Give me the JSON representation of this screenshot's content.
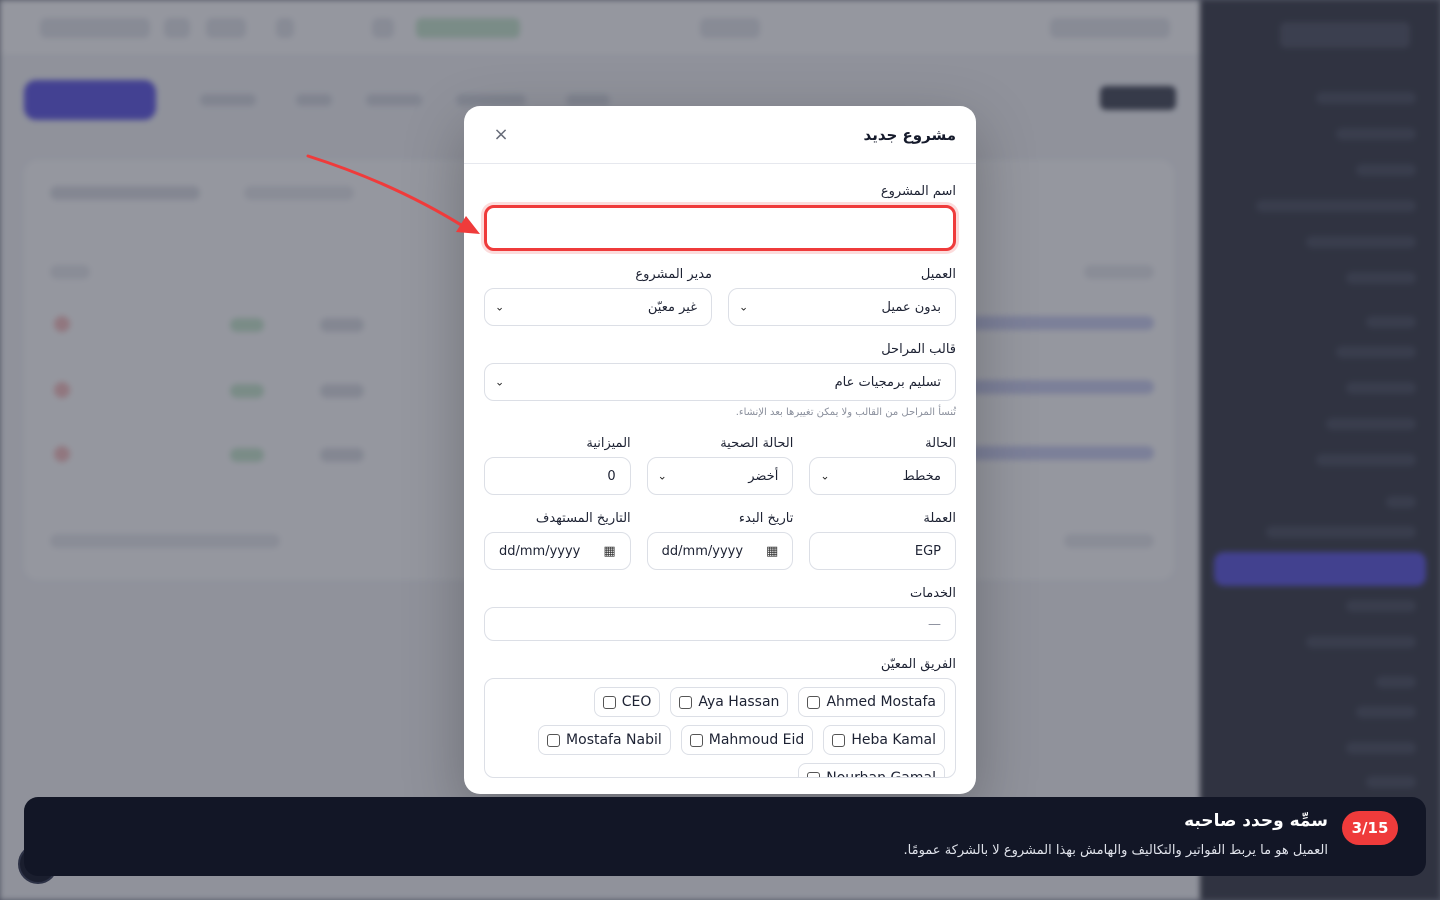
{
  "modal": {
    "title": "مشروع جديد",
    "close_icon": "×",
    "project_name": {
      "label": "اسم المشروع",
      "value": ""
    },
    "client": {
      "label": "العميل",
      "value": "بدون عميل"
    },
    "manager": {
      "label": "مدير المشروع",
      "value": "غير معيّن"
    },
    "phase_template": {
      "label": "قالب المراحل",
      "value": "تسليم برمجيات عام",
      "help": "تُنسأ المراحل من القالب ولا يمكن تغييرها بعد الإنشاء."
    },
    "status": {
      "label": "الحالة",
      "value": "مخطط"
    },
    "health": {
      "label": "الحالة الصحية",
      "value": "أخضر"
    },
    "budget": {
      "label": "الميزانية",
      "value": "0"
    },
    "currency": {
      "label": "العملة",
      "value": "EGP"
    },
    "start_date": {
      "label": "تاريخ البدء",
      "value": "dd/mm/yyyy"
    },
    "target_date": {
      "label": "التاريخ المستهدف",
      "value": "dd/mm/yyyy"
    },
    "services": {
      "label": "الخدمات",
      "value": "—"
    },
    "team": {
      "label": "الفريق المعيّن",
      "members": [
        "Ahmed Mostafa",
        "Aya Hassan",
        "CEO",
        "Heba Kamal",
        "Mahmoud Eid",
        "Mostafa Nabil",
        "Nourhan Gamal"
      ]
    }
  },
  "tour": {
    "step": "3/15",
    "title": "سمِّه وحدد صاحبه",
    "text": "العميل هو ما يربط الفواتير والتكاليف والهامش بهذا المشروع لا بالشركة عمومًا.",
    "accent_color": "#ef3b3b"
  },
  "icons": {
    "close": "close-icon",
    "chevron": "chevron-down-icon",
    "calendar": "calendar-icon"
  }
}
